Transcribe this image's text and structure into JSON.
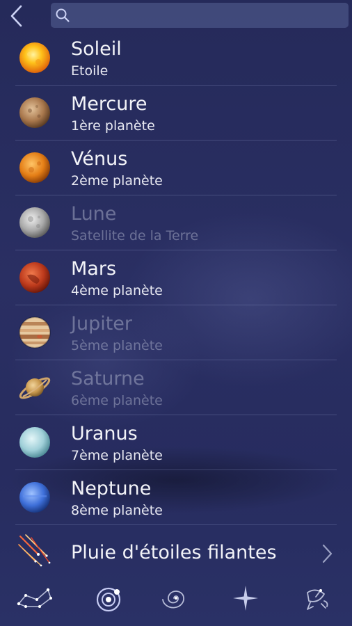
{
  "search": {
    "value": "",
    "placeholder": ""
  },
  "items": [
    {
      "name": "Soleil",
      "subtitle": "Etoile",
      "icon": "sun-icon",
      "dimmed": false
    },
    {
      "name": "Mercure",
      "subtitle": "1ère planète",
      "icon": "mercury-icon",
      "dimmed": false
    },
    {
      "name": "Vénus",
      "subtitle": "2ème planète",
      "icon": "venus-icon",
      "dimmed": false
    },
    {
      "name": "Lune",
      "subtitle": "Satellite de la Terre",
      "icon": "moon-icon",
      "dimmed": true
    },
    {
      "name": "Mars",
      "subtitle": "4ème planète",
      "icon": "mars-icon",
      "dimmed": false
    },
    {
      "name": "Jupiter",
      "subtitle": "5ème planète",
      "icon": "jupiter-icon",
      "dimmed": true
    },
    {
      "name": "Saturne",
      "subtitle": "6ème planète",
      "icon": "saturn-icon",
      "dimmed": true
    },
    {
      "name": "Uranus",
      "subtitle": "7ème planète",
      "icon": "uranus-icon",
      "dimmed": false
    },
    {
      "name": "Neptune",
      "subtitle": "8ème planète",
      "icon": "neptune-icon",
      "dimmed": false
    }
  ],
  "meteor": {
    "label": "Pluie d'étoiles filantes",
    "icon": "meteor-shower-icon"
  },
  "tabs": [
    {
      "icon": "constellation-icon",
      "active": false
    },
    {
      "icon": "solar-system-icon",
      "active": true
    },
    {
      "icon": "galaxy-icon",
      "active": false
    },
    {
      "icon": "star-icon",
      "active": false
    },
    {
      "icon": "satellite-icon",
      "active": false
    }
  ],
  "colors": {
    "background": "#272c5f",
    "text": "#f2f3f8",
    "dimmed_text": "#8d91ad",
    "search_field": "#4a5288"
  }
}
